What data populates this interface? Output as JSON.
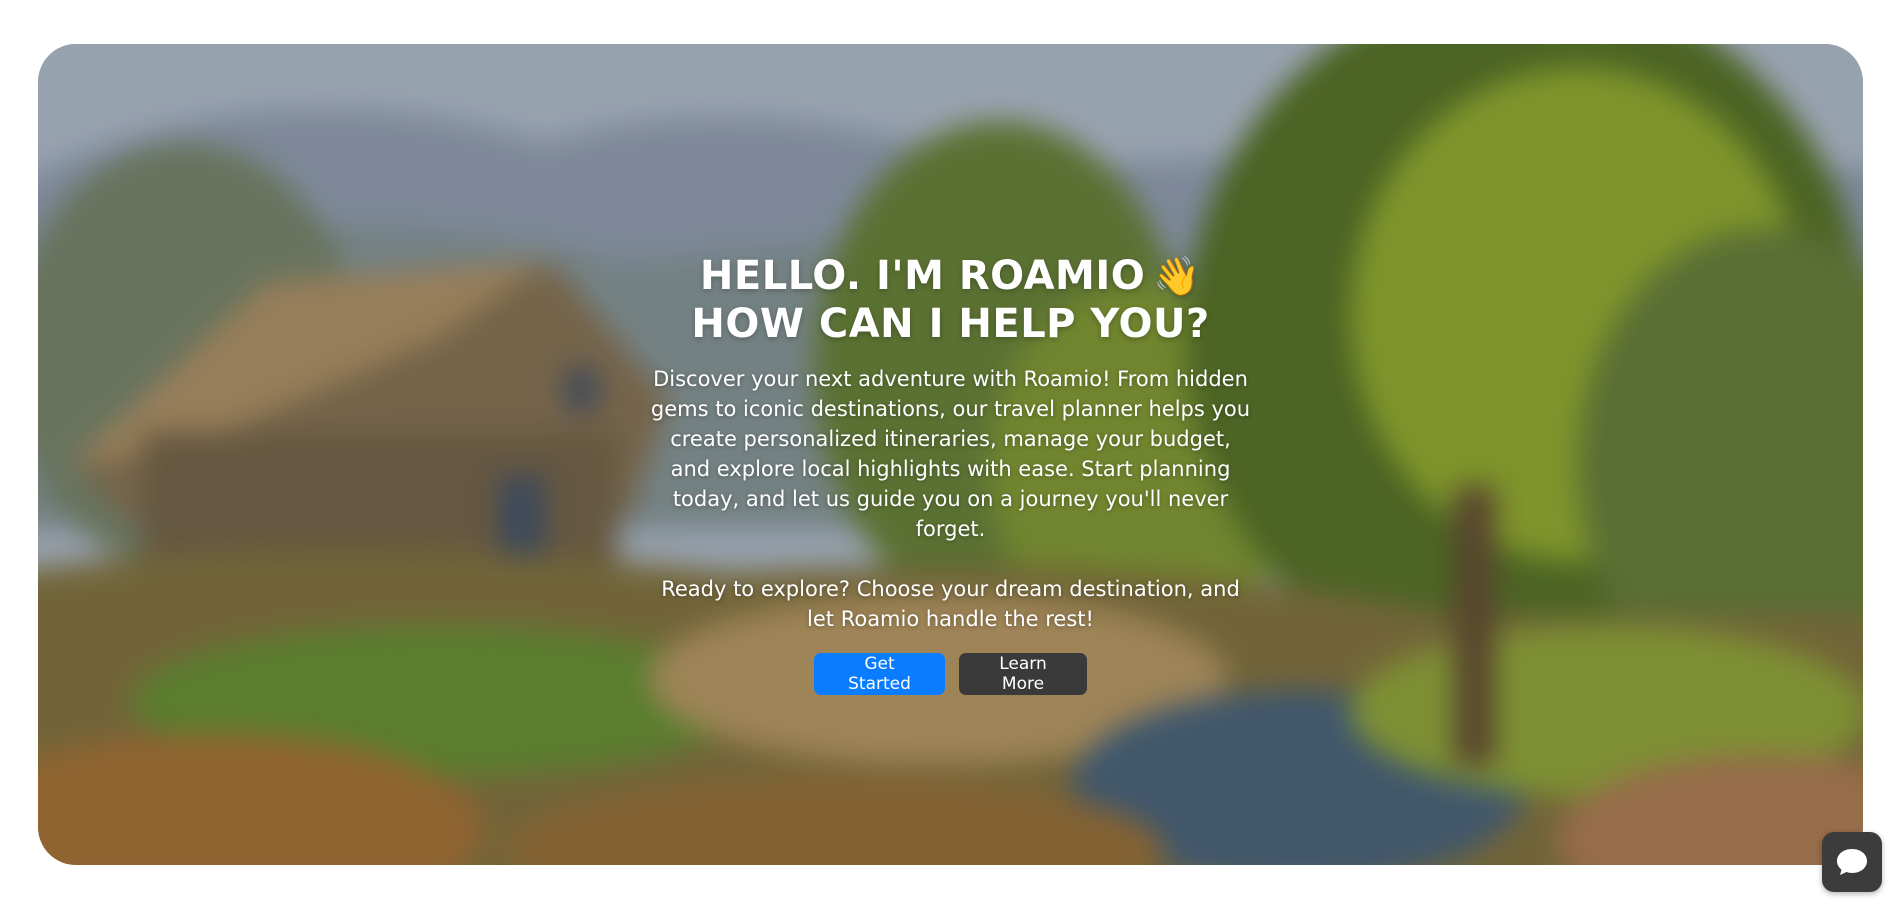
{
  "hero": {
    "title_line1": "HELLO. I'M ROAMIO",
    "title_emoji": "👋",
    "title_line2": "HOW CAN I HELP YOU?",
    "description": "Discover your next adventure with Roamio! From hidden gems to iconic destinations, our travel planner helps you create personalized itineraries, manage your budget, and explore local highlights with ease. Start planning today, and let us guide you on a journey you'll never forget.",
    "cta_text": "Ready to explore? Choose your dream destination, and let Roamio handle the rest!",
    "get_started_label": "Get Started",
    "learn_more_label": "Learn More",
    "background_image": "blurred-painting-of-cabin-in-forest"
  },
  "chat_widget": {
    "icon": "chat-bubble-icon"
  },
  "colors": {
    "primary_button": "#0a7cff",
    "secondary_button": "#3a3a3a",
    "chat_button": "#3c3c3c",
    "text": "#ffffff"
  }
}
